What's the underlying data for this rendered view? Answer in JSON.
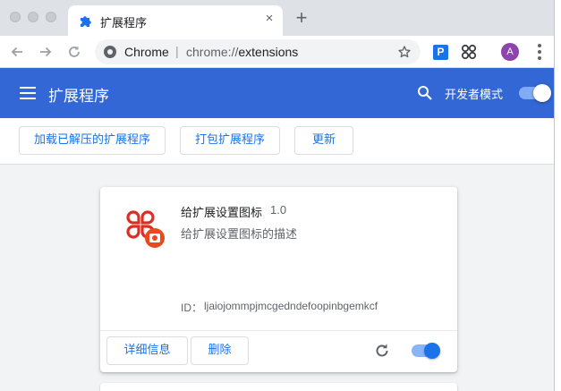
{
  "tab": {
    "title": "扩展程序",
    "close": "×",
    "new_tab": "+"
  },
  "toolbar": {
    "origin_label": "Chrome",
    "separator": "|",
    "url_scheme": "chrome://",
    "url_host": "extensions",
    "profile_initial": "A",
    "ext_p_label": "P"
  },
  "header": {
    "title": "扩展程序",
    "developer_mode_label": "开发者模式",
    "developer_mode_on": true
  },
  "actions": {
    "load_unpacked": "加载已解压的扩展程序",
    "pack": "打包扩展程序",
    "update": "更新"
  },
  "extension": {
    "name": "给扩展设置图标",
    "version": "1.0",
    "description": "给扩展设置图标的描述",
    "id_label": "ID：",
    "id": "ljaiojommpjmcgedndefoopinbgemkcf",
    "details_button": "详细信息",
    "remove_button": "删除",
    "enabled": true
  },
  "colors": {
    "header_bg": "#3367d6",
    "accent": "#1a73e8",
    "icon_red": "#e8491d"
  }
}
